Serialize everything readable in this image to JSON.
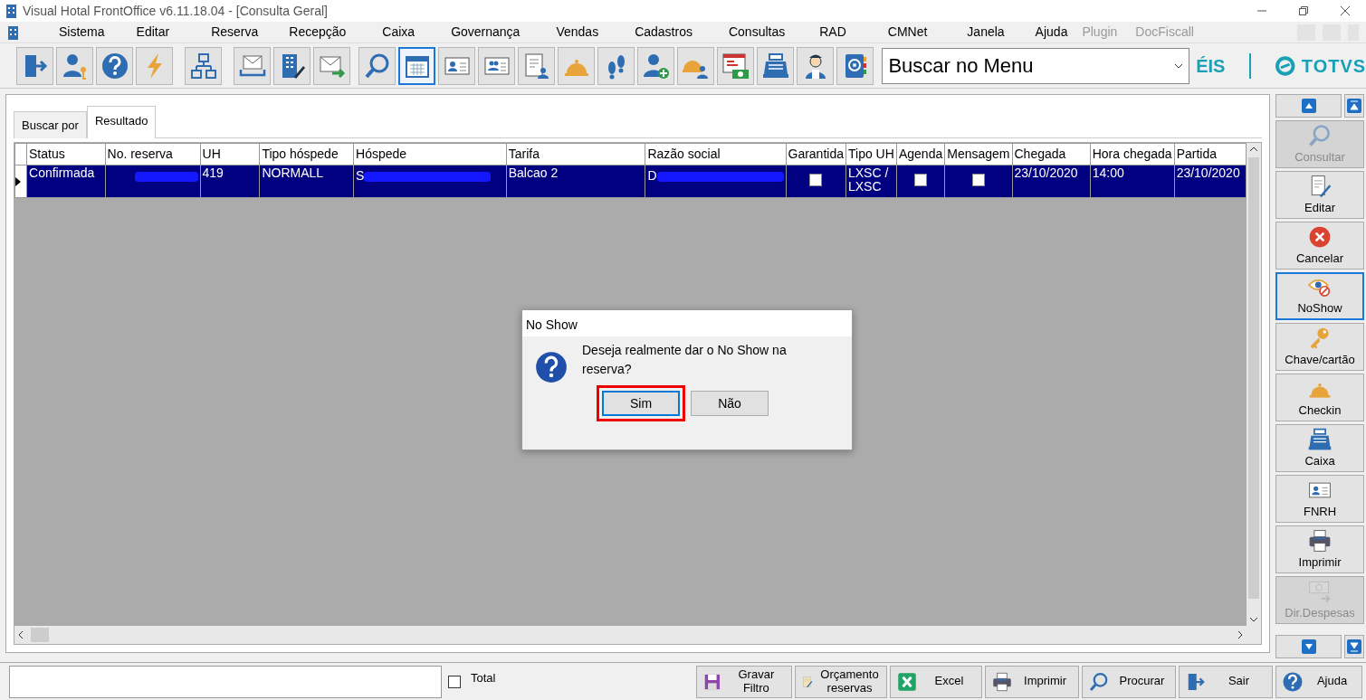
{
  "window": {
    "title": "Visual Hotal FrontOffice v6.11.18.04 - [Consulta Geral]"
  },
  "menu": [
    {
      "label": "Sistema",
      "disabled": false
    },
    {
      "label": "Editar",
      "disabled": false
    },
    {
      "label": "Reserva",
      "disabled": false
    },
    {
      "label": "Recepção",
      "disabled": false
    },
    {
      "label": "Caixa",
      "disabled": false
    },
    {
      "label": "Governança",
      "disabled": false
    },
    {
      "label": "Vendas",
      "disabled": false
    },
    {
      "label": "Cadastros",
      "disabled": false
    },
    {
      "label": "Consultas",
      "disabled": false
    },
    {
      "label": "RAD",
      "disabled": false
    },
    {
      "label": "CMNet",
      "disabled": false
    },
    {
      "label": "Janela",
      "disabled": false
    },
    {
      "label": "Ajuda",
      "disabled": false
    },
    {
      "label": "Plugin",
      "disabled": true
    },
    {
      "label": "DocFiscall",
      "disabled": true
    }
  ],
  "toolbar": [
    {
      "kind": "exit",
      "selected": false
    },
    {
      "kind": "userkey",
      "selected": false
    },
    {
      "kind": "help",
      "selected": false
    },
    {
      "kind": "bolt",
      "selected": false
    },
    {
      "kind": "sitemap",
      "selected": false
    },
    {
      "kind": "mailtray",
      "selected": false
    },
    {
      "kind": "building",
      "selected": false
    },
    {
      "kind": "mailsend",
      "selected": false
    },
    {
      "kind": "search",
      "selected": false
    },
    {
      "kind": "calendar",
      "selected": true
    },
    {
      "kind": "idcard",
      "selected": false
    },
    {
      "kind": "idgroup",
      "selected": false
    },
    {
      "kind": "report",
      "selected": false
    },
    {
      "kind": "bell",
      "selected": false
    },
    {
      "kind": "feet",
      "selected": false
    },
    {
      "kind": "useradd",
      "selected": false
    },
    {
      "kind": "bellusers",
      "selected": false
    },
    {
      "kind": "invoice",
      "selected": false
    },
    {
      "kind": "register",
      "selected": false
    },
    {
      "kind": "maid",
      "selected": false
    },
    {
      "kind": "book",
      "selected": false
    }
  ],
  "menu_search": {
    "value": "Buscar no Menu"
  },
  "brand": {
    "left": "ÉIS",
    "right": "TOTVS"
  },
  "tabs": [
    {
      "label": "Buscar por",
      "selected": false
    },
    {
      "label": "Resultado",
      "selected": true
    }
  ],
  "table": {
    "columns": [
      "Status",
      "No. reserva",
      "UH",
      "Tipo hóspede",
      "Hóspede",
      "Tarifa",
      "Razão social",
      "Garantida",
      "Tipo UH",
      "Agenda",
      "Mensagem",
      "Chegada",
      "Hora chegada",
      "Partida"
    ],
    "rows": [
      {
        "selected": true,
        "cells": [
          {
            "kind": "text",
            "text": "Confirmada"
          },
          {
            "kind": "redacted"
          },
          {
            "kind": "text",
            "text": "419"
          },
          {
            "kind": "text",
            "text": "NORMALL"
          },
          {
            "kind": "redacted",
            "text": "S"
          },
          {
            "kind": "text",
            "text": "Balcao 2"
          },
          {
            "kind": "redacted",
            "text": "D"
          },
          {
            "kind": "check",
            "checked": false
          },
          {
            "kind": "text",
            "text": "LXSC / LXSC"
          },
          {
            "kind": "check",
            "checked": false
          },
          {
            "kind": "check",
            "checked": false
          },
          {
            "kind": "text",
            "text": "23/10/2020"
          },
          {
            "kind": "text",
            "text": "14:00"
          },
          {
            "kind": "text",
            "text": "23/10/2020"
          }
        ]
      }
    ]
  },
  "sidebar": [
    {
      "label": "Consultar",
      "kind": "search",
      "disabled": true,
      "selected": false
    },
    {
      "label": "Editar",
      "kind": "edit",
      "disabled": false,
      "selected": false
    },
    {
      "label": "Cancelar",
      "kind": "cancel",
      "disabled": false,
      "selected": false
    },
    {
      "label": "NoShow",
      "kind": "noshow",
      "disabled": false,
      "selected": true
    },
    {
      "label": "Chave/cartão",
      "kind": "key",
      "disabled": false,
      "selected": false
    },
    {
      "label": "Checkin",
      "kind": "bell",
      "disabled": false,
      "selected": false
    },
    {
      "label": "Caixa",
      "kind": "register",
      "disabled": false,
      "selected": false
    },
    {
      "label": "FNRH",
      "kind": "idcard",
      "disabled": false,
      "selected": false
    },
    {
      "label": "Imprimir",
      "kind": "printer",
      "disabled": false,
      "selected": false
    },
    {
      "label": "Dir.Despesas",
      "kind": "money",
      "disabled": true,
      "selected": false
    }
  ],
  "dialog": {
    "title": "No Show",
    "message": "Deseja realmente dar o No Show na reserva?",
    "buttons": [
      {
        "label": "Sim",
        "selected": true,
        "highlighted": true
      },
      {
        "label": "Não",
        "selected": false,
        "highlighted": false
      }
    ]
  },
  "footer": {
    "total": {
      "label": "Total",
      "checked": false
    },
    "buttons": [
      {
        "label": "Gravar Filtro",
        "kind": "save"
      },
      {
        "label": "Orçamento reservas",
        "kind": "budget"
      },
      {
        "label": "Excel",
        "kind": "excel"
      },
      {
        "label": "Imprimir",
        "kind": "printer"
      },
      {
        "label": "Procurar",
        "kind": "search"
      },
      {
        "label": "Sair",
        "kind": "exit"
      },
      {
        "label": "Ajuda",
        "kind": "help"
      }
    ]
  }
}
